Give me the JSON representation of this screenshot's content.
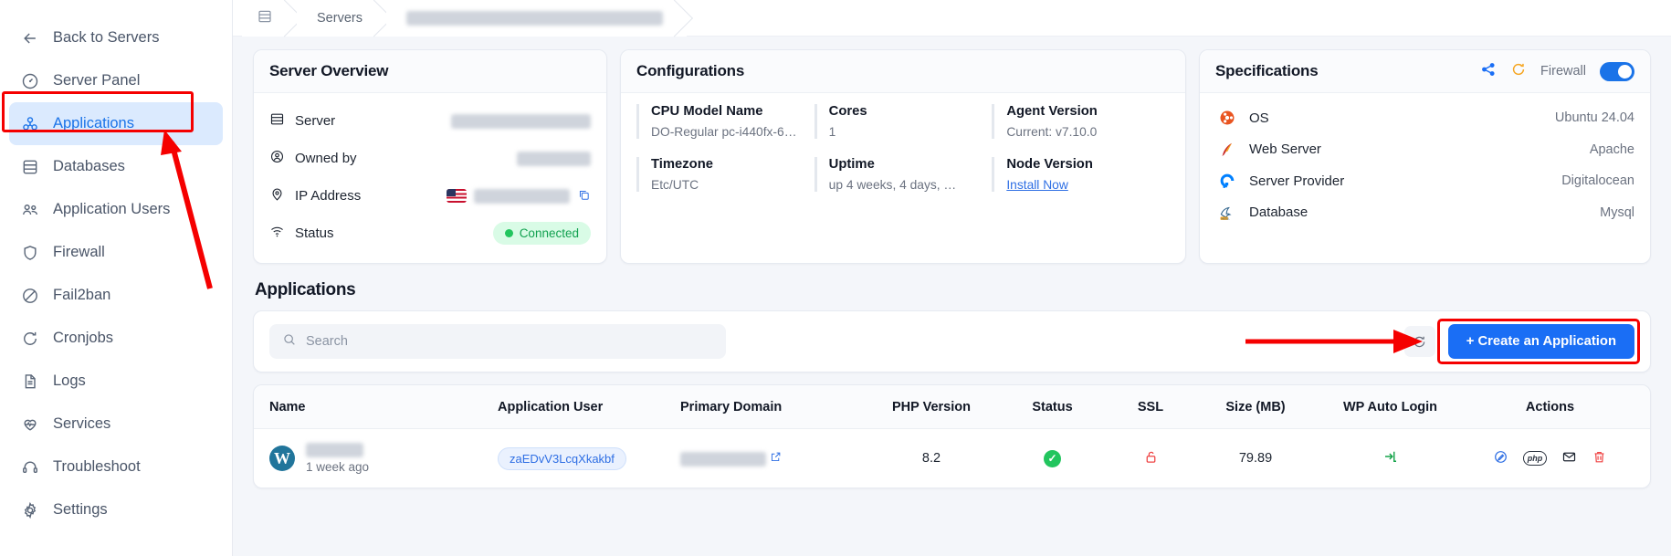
{
  "sidebar": {
    "items": [
      {
        "label": "Back to Servers",
        "icon": "arrow-left-icon",
        "active": false
      },
      {
        "label": "Server Panel",
        "icon": "gauge-icon",
        "active": false
      },
      {
        "label": "Applications",
        "icon": "apps-grid-icon",
        "active": true
      },
      {
        "label": "Databases",
        "icon": "database-icon",
        "active": false
      },
      {
        "label": "Application Users",
        "icon": "users-icon",
        "active": false
      },
      {
        "label": "Firewall",
        "icon": "shield-icon",
        "active": false
      },
      {
        "label": "Fail2ban",
        "icon": "ban-icon",
        "active": false
      },
      {
        "label": "Cronjobs",
        "icon": "refresh-clock-icon",
        "active": false
      },
      {
        "label": "Logs",
        "icon": "file-text-icon",
        "active": false
      },
      {
        "label": "Services",
        "icon": "heart-pulse-icon",
        "active": false
      },
      {
        "label": "Troubleshoot",
        "icon": "headset-icon",
        "active": false
      },
      {
        "label": "Settings",
        "icon": "gear-icon",
        "active": false
      }
    ]
  },
  "breadcrumb": {
    "home_icon": "server-icon",
    "items": [
      "Servers",
      "whitelabel - dont - delete (104.248.121.224)"
    ],
    "redacted_index": 1
  },
  "overview": {
    "title": "Server Overview",
    "rows": [
      {
        "label": "Server",
        "icon": "server-icon",
        "value": "whitelabel - dont - delete",
        "redacted": true
      },
      {
        "label": "Owned by",
        "icon": "user-circle-icon",
        "value": "Smit Pipaliya",
        "redacted": true
      },
      {
        "label": "IP Address",
        "icon": "map-pin-icon",
        "value": "104.248.121.224",
        "redacted": true,
        "flag": "us-flag",
        "copy": "copy-icon"
      },
      {
        "label": "Status",
        "icon": "wifi-icon",
        "value": "Connected",
        "redacted": false,
        "badge": true
      }
    ]
  },
  "configurations": {
    "title": "Configurations",
    "cells": [
      {
        "key": "CPU Model Name",
        "value": "DO-Regular pc-i440fx-6…"
      },
      {
        "key": "Cores",
        "value": "1"
      },
      {
        "key": "Agent Version",
        "value": "Current: v7.10.0"
      },
      {
        "key": "Timezone",
        "value": "Etc/UTC"
      },
      {
        "key": "Uptime",
        "value": "up 4 weeks, 4 days, …"
      },
      {
        "key": "Node Version",
        "value": "Install Now",
        "link": true
      }
    ]
  },
  "specifications": {
    "title": "Specifications",
    "share_icon": "share-nodes-icon",
    "refresh_icon": "refresh-icon",
    "firewall_label": "Firewall",
    "firewall_on": true,
    "rows": [
      {
        "label": "OS",
        "value": "Ubuntu 24.04",
        "icon": "ubuntu-icon"
      },
      {
        "label": "Web Server",
        "value": "Apache",
        "icon": "apache-feather-icon"
      },
      {
        "label": "Server Provider",
        "value": "Digitalocean",
        "icon": "digitalocean-icon"
      },
      {
        "label": "Database",
        "value": "Mysql",
        "icon": "mysql-dolphin-icon"
      }
    ]
  },
  "applications": {
    "section_title": "Applications",
    "search_placeholder": "Search",
    "search_value": "",
    "refresh_icon": "refresh-icon",
    "create_button": "+ Create an Application",
    "columns": [
      "Name",
      "Application User",
      "Primary Domain",
      "PHP Version",
      "Status",
      "SSL",
      "Size (MB)",
      "WP Auto Login",
      "Actions"
    ],
    "rows": [
      {
        "platform_icon": "wordpress-icon",
        "name": "wergwerg",
        "name_redacted": true,
        "created_ago": "1 week ago",
        "application_user": "zaEDvV3LcqXkakbf",
        "primary_domain": "wergwerg.com",
        "domain_redacted": true,
        "domain_external_icon": "external-link-icon",
        "php_version": "8.2",
        "status": "ok",
        "ssl": "unlocked",
        "size_mb": "79.89",
        "wp_auto_login_icon": "login-arrow-icon",
        "actions": [
          "edit-icon",
          "php-icon",
          "mail-icon",
          "trash-icon"
        ]
      }
    ]
  },
  "annotations": {
    "highlight_color": "#f50000",
    "arrow_to_applications": true,
    "arrow_to_create_button": true
  },
  "colors": {
    "accent": "#1a6ef5",
    "active_nav_bg": "#dbeafe",
    "active_nav_text": "#1a73e8",
    "success": "#22c55e",
    "danger": "#ef4444",
    "highlight": "#f50000"
  }
}
